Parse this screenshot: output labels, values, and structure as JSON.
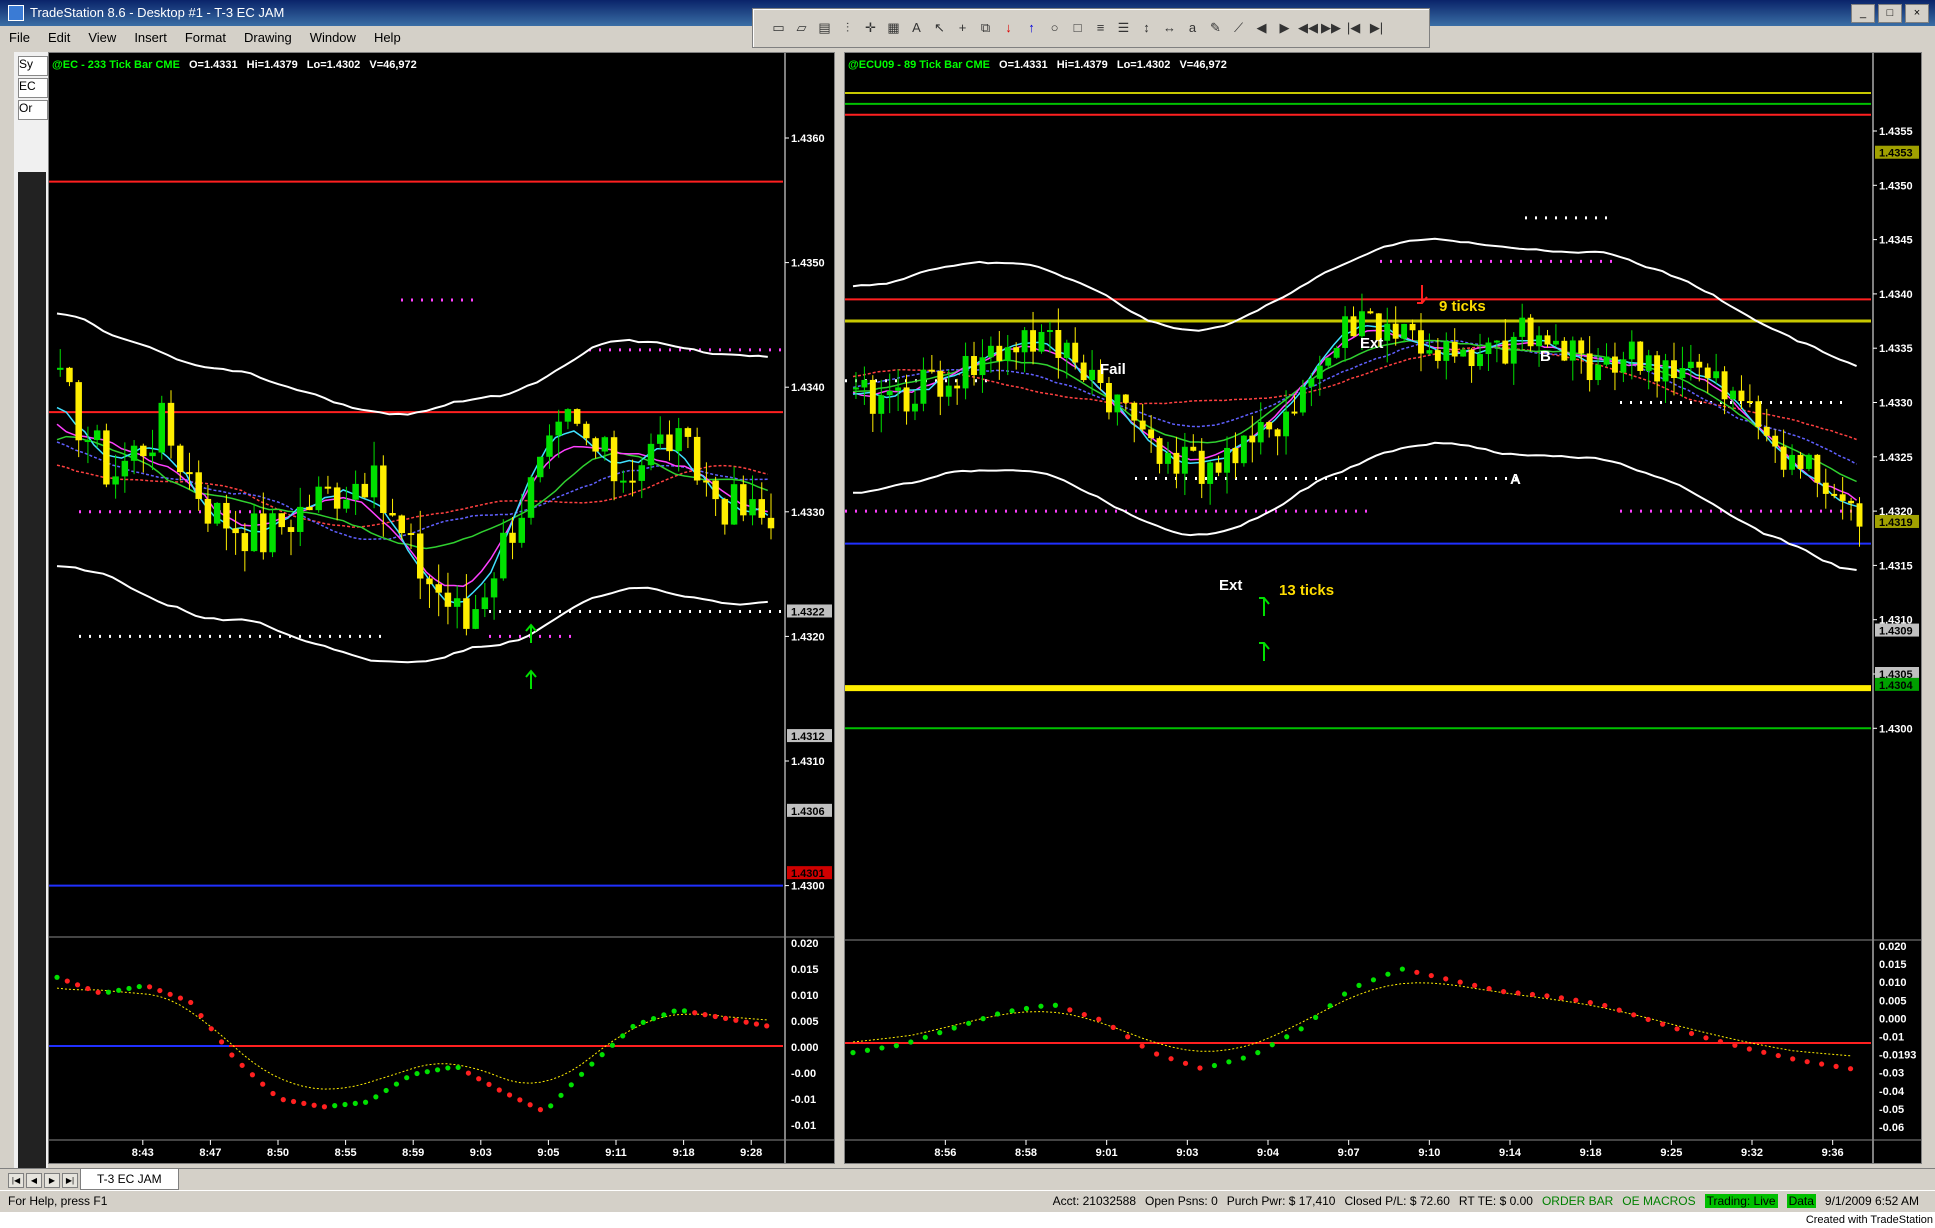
{
  "window": {
    "title": "TradeStation 8.6 - Desktop #1 - T-3 EC JAM",
    "controls": [
      "_",
      "□",
      "×"
    ]
  },
  "menu": [
    "File",
    "Edit",
    "View",
    "Insert",
    "Format",
    "Drawing",
    "Window",
    "Help"
  ],
  "toolbar_icons": [
    "folder-icon",
    "folder-open-icon",
    "book-icon",
    "bars-icon",
    "crosshair-icon",
    "grid-icon",
    "text-icon",
    "pointer-icon",
    "plus-icon",
    "copy-icon",
    "down-arrow-icon",
    "up-arrow-icon",
    "ellipse-icon",
    "rect-icon",
    "fib-icon",
    "lines-icon",
    "vline-icon",
    "hline-icon",
    "abc-icon",
    "pen-icon",
    "trend-icon",
    "left-icon",
    "right-icon",
    "rewind-icon",
    "forward-icon",
    "first-icon",
    "last-icon"
  ],
  "left_strip": [
    "Sy",
    "EC",
    "Or"
  ],
  "colors": {
    "up": "#00e000",
    "down": "#ffee00",
    "red": "#ff2020",
    "blue": "#2030ff",
    "magenta": "#ff40ff",
    "white": "#ffffff",
    "cyan": "#40e0ff"
  },
  "left_chart": {
    "header": {
      "symbol": "@EC - 233 Tick Bar CME",
      "open": "O=1.4331",
      "high": "Hi=1.4379",
      "low": "Lo=1.4302",
      "vol": "V=46,972"
    },
    "price_axis": [
      "1.4360",
      "1.4350",
      "1.4340",
      "1.4330",
      "1.4320",
      "1.4310",
      "1.4300"
    ],
    "price_tags": [
      {
        "label": "1.4322",
        "bg": "#c0c0c0"
      },
      {
        "label": "1.4312",
        "bg": "#c0c0c0"
      },
      {
        "label": "1.4306",
        "bg": "#c0c0c0"
      },
      {
        "label": "1.4301",
        "bg": "#d00000"
      }
    ],
    "osc_axis": [
      "0.020",
      "0.015",
      "0.010",
      "0.005",
      "0.000",
      "-0.00",
      "-0.01",
      "-0.01"
    ],
    "time_axis": [
      "8:43",
      "8:47",
      "8:50",
      "8:55",
      "8:59",
      "9:03",
      "9:05",
      "9:11",
      "9:18",
      "9:28"
    ]
  },
  "right_chart": {
    "header": {
      "symbol": "@ECU09 - 89 Tick Bar CME",
      "open": "O=1.4331",
      "high": "Hi=1.4379",
      "low": "Lo=1.4302",
      "vol": "V=46,972"
    },
    "price_axis": [
      "1.4355",
      "1.4350",
      "1.4345",
      "1.4340",
      "1.4335",
      "1.4330",
      "1.4325",
      "1.4320",
      "1.4315",
      "1.4310",
      "1.4305",
      "1.4300"
    ],
    "price_tags": [
      {
        "label": "1.4353",
        "bg": "#a0a000"
      },
      {
        "label": "1.4319",
        "bg": "#a0a000"
      },
      {
        "label": "1.4309",
        "bg": "#c0c0c0"
      },
      {
        "label": "1.4305",
        "bg": "#c0c0c0"
      },
      {
        "label": "1.4304",
        "bg": "#00a000"
      }
    ],
    "osc_axis": [
      "0.020",
      "0.015",
      "0.010",
      "0.005",
      "0.000",
      "-0.01",
      "-0.0193",
      "-0.03",
      "-0.04",
      "-0.05",
      "-0.06"
    ],
    "time_axis": [
      "8:56",
      "8:58",
      "9:01",
      "9:03",
      "9:04",
      "9:07",
      "9:10",
      "9:14",
      "9:18",
      "9:25",
      "9:32",
      "9:36"
    ],
    "annotations": {
      "fail": "Fail",
      "ext_top": "Ext",
      "ext_bottom": "Ext",
      "b": "B",
      "a": "A",
      "nine_ticks": "9 ticks",
      "thirteen_ticks": "13 ticks"
    }
  },
  "tab": {
    "label": "T-3 EC JAM"
  },
  "status": {
    "help": "For Help, press F1",
    "acct": "Acct: 21032588",
    "open_posns": "Open Psns: 0",
    "purch_pwr": "Purch Pwr: $ 17,410",
    "closed_pl": "Closed P/L: $ 72.60",
    "rt_te": "RT TE: $ 0.00",
    "order_bar": "ORDER BAR",
    "oe_macros": "OE MACROS",
    "trading": "Trading: Live",
    "data": "Data",
    "datetime": "9/1/2009 6:52 AM"
  },
  "footer": "Created with TradeStation"
}
